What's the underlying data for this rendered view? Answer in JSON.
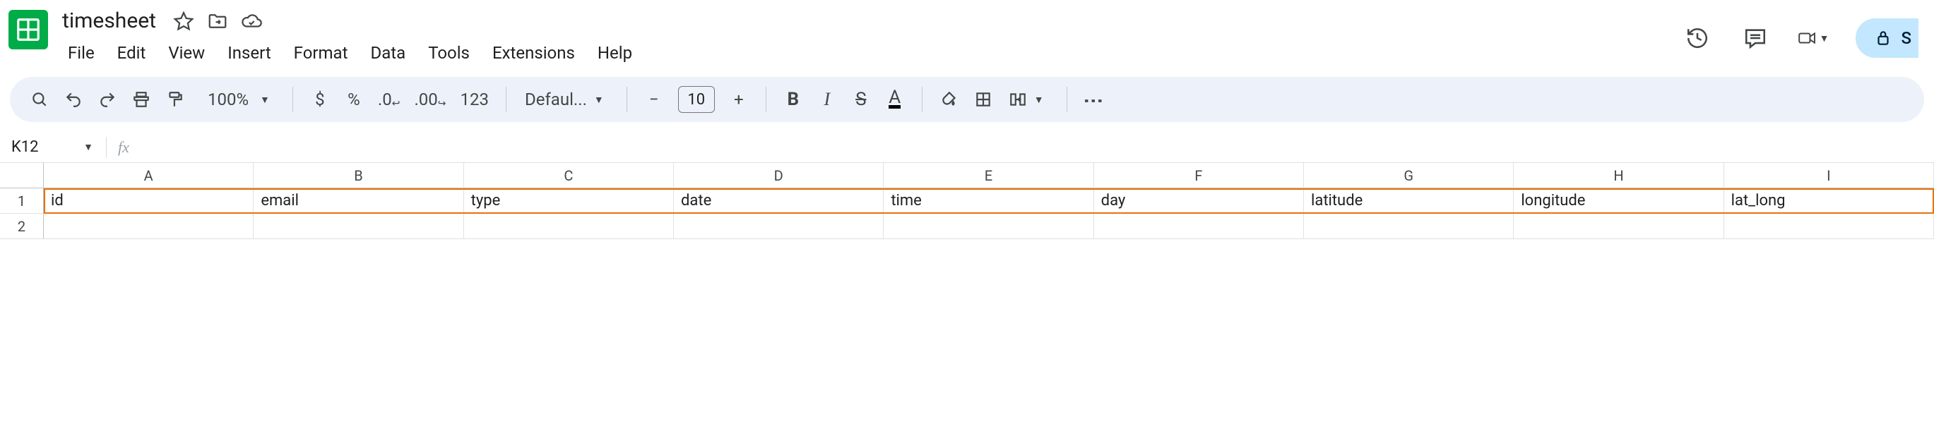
{
  "doc": {
    "title": "timesheet"
  },
  "menus": [
    "File",
    "Edit",
    "View",
    "Insert",
    "Format",
    "Data",
    "Tools",
    "Extensions",
    "Help"
  ],
  "toolbar": {
    "zoom": "100%",
    "currency": "$",
    "percent": "%",
    "dec_dec": ".0",
    "inc_dec": ".00",
    "num_fmt": "123",
    "font_name": "Defaul...",
    "minus": "−",
    "font_size": "10",
    "plus": "+",
    "bold": "B",
    "italic": "I",
    "strike": "S",
    "text_color": "A"
  },
  "share": {
    "label": "S"
  },
  "namebox": {
    "value": "K12"
  },
  "fx": {
    "symbol": "fx"
  },
  "columns": [
    "A",
    "B",
    "C",
    "D",
    "E",
    "F",
    "G",
    "H",
    "I"
  ],
  "rows": [
    "1",
    "2"
  ],
  "data": {
    "r1": [
      "id",
      "email",
      "type",
      "date",
      "time",
      "day",
      "latitude",
      "longitude",
      "lat_long"
    ],
    "r2": [
      "",
      "",
      "",
      "",
      "",
      "",
      "",
      "",
      ""
    ]
  }
}
